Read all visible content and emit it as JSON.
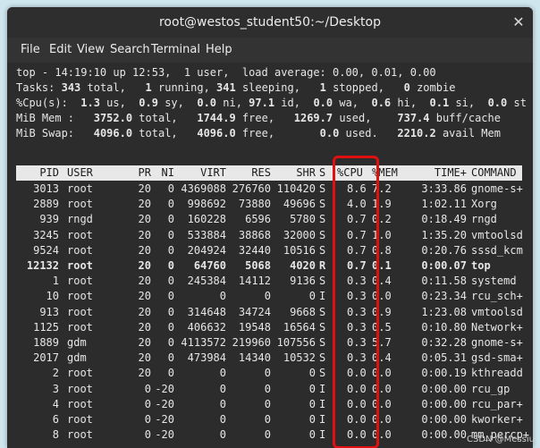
{
  "window": {
    "title": "root@westos_student50:~/Desktop"
  },
  "menu": [
    "File",
    "Edit",
    "View",
    "Search",
    "Terminal",
    "Help"
  ],
  "summary": {
    "line1": "top - 14:19:10 up 12:53,  1 user,  load average: 0.00, 0.01, 0.00",
    "tasks": {
      "label": "Tasks:",
      "total": "343",
      "total_lbl": " total,",
      "running": "1",
      "running_lbl": " running,",
      "sleeping": "341",
      "sleeping_lbl": " sleeping,",
      "stopped": "1",
      "stopped_lbl": " stopped,",
      "zombie": "0",
      "zombie_lbl": " zombie"
    },
    "cpu": {
      "label": "%Cpu(s):",
      "us": "1.3",
      "us_lbl": " us,",
      "sy": "0.9",
      "sy_lbl": " sy,",
      "ni": "0.0",
      "ni_lbl": " ni,",
      "id": "97.1",
      "id_lbl": " id,",
      "wa": "0.0",
      "wa_lbl": " wa,",
      "hi": "0.6",
      "hi_lbl": " hi,",
      "si": "0.1",
      "si_lbl": " si,",
      "st": "0.0",
      "st_lbl": " st"
    },
    "mem": {
      "label": "MiB Mem :",
      "total": "3752.0",
      "total_lbl": " total,",
      "free": "1744.9",
      "free_lbl": " free,",
      "used": "1269.7",
      "used_lbl": " used,",
      "buff": "737.4",
      "buff_lbl": " buff/cache"
    },
    "swap": {
      "label": "MiB Swap:",
      "total": "4096.0",
      "total_lbl": " total,",
      "free": "4096.0",
      "free_lbl": " free,",
      "used": "0.0",
      "used_lbl": " used.",
      "avail": "2210.2",
      "avail_lbl": " avail Mem"
    }
  },
  "table": {
    "headers": {
      "pid": "PID",
      "user": "USER",
      "pr": "PR",
      "ni": "NI",
      "virt": "VIRT",
      "res": "RES",
      "shr": "SHR",
      "s": "S",
      "cpu": "%CPU",
      "mem": "%MEM",
      "time": "TIME+",
      "command": "COMMAND"
    },
    "rows": [
      {
        "pid": "3013",
        "user": "root",
        "pr": "20",
        "ni": "0",
        "virt": "4369088",
        "res": "276760",
        "shr": "110420",
        "s": "S",
        "cpu": "8.6",
        "mem": "7.2",
        "time": "3:33.86",
        "command": "gnome-s+"
      },
      {
        "pid": "2889",
        "user": "root",
        "pr": "20",
        "ni": "0",
        "virt": "998692",
        "res": "73880",
        "shr": "49696",
        "s": "S",
        "cpu": "4.0",
        "mem": "1.9",
        "time": "1:02.11",
        "command": "Xorg"
      },
      {
        "pid": "939",
        "user": "rngd",
        "pr": "20",
        "ni": "0",
        "virt": "160228",
        "res": "6596",
        "shr": "5780",
        "s": "S",
        "cpu": "0.7",
        "mem": "0.2",
        "time": "0:18.49",
        "command": "rngd"
      },
      {
        "pid": "3245",
        "user": "root",
        "pr": "20",
        "ni": "0",
        "virt": "533884",
        "res": "38868",
        "shr": "32000",
        "s": "S",
        "cpu": "0.7",
        "mem": "1.0",
        "time": "1:35.20",
        "command": "vmtoolsd"
      },
      {
        "pid": "9524",
        "user": "root",
        "pr": "20",
        "ni": "0",
        "virt": "204924",
        "res": "32440",
        "shr": "10516",
        "s": "S",
        "cpu": "0.7",
        "mem": "0.8",
        "time": "0:20.76",
        "command": "sssd_kcm"
      },
      {
        "pid": "12132",
        "user": "root",
        "pr": "20",
        "ni": "0",
        "virt": "64760",
        "res": "5068",
        "shr": "4020",
        "s": "R",
        "cpu": "0.7",
        "mem": "0.1",
        "time": "0:00.07",
        "command": "top",
        "bold": true
      },
      {
        "pid": "1",
        "user": "root",
        "pr": "20",
        "ni": "0",
        "virt": "245384",
        "res": "14112",
        "shr": "9136",
        "s": "S",
        "cpu": "0.3",
        "mem": "0.4",
        "time": "0:11.58",
        "command": "systemd"
      },
      {
        "pid": "10",
        "user": "root",
        "pr": "20",
        "ni": "0",
        "virt": "0",
        "res": "0",
        "shr": "0",
        "s": "I",
        "cpu": "0.3",
        "mem": "0.0",
        "time": "0:23.34",
        "command": "rcu_sch+"
      },
      {
        "pid": "913",
        "user": "root",
        "pr": "20",
        "ni": "0",
        "virt": "314648",
        "res": "34724",
        "shr": "9668",
        "s": "S",
        "cpu": "0.3",
        "mem": "0.9",
        "time": "1:23.08",
        "command": "vmtoolsd"
      },
      {
        "pid": "1125",
        "user": "root",
        "pr": "20",
        "ni": "0",
        "virt": "406632",
        "res": "19548",
        "shr": "16564",
        "s": "S",
        "cpu": "0.3",
        "mem": "0.5",
        "time": "0:10.80",
        "command": "Network+"
      },
      {
        "pid": "1889",
        "user": "gdm",
        "pr": "20",
        "ni": "0",
        "virt": "4113572",
        "res": "219960",
        "shr": "107556",
        "s": "S",
        "cpu": "0.3",
        "mem": "5.7",
        "time": "0:32.28",
        "command": "gnome-s+"
      },
      {
        "pid": "2017",
        "user": "gdm",
        "pr": "20",
        "ni": "0",
        "virt": "473984",
        "res": "14340",
        "shr": "10532",
        "s": "S",
        "cpu": "0.3",
        "mem": "0.4",
        "time": "0:05.31",
        "command": "gsd-sma+"
      },
      {
        "pid": "2",
        "user": "root",
        "pr": "20",
        "ni": "0",
        "virt": "0",
        "res": "0",
        "shr": "0",
        "s": "S",
        "cpu": "0.0",
        "mem": "0.0",
        "time": "0:00.19",
        "command": "kthreadd"
      },
      {
        "pid": "3",
        "user": "root",
        "pr": "0",
        "ni": "-20",
        "virt": "0",
        "res": "0",
        "shr": "0",
        "s": "I",
        "cpu": "0.0",
        "mem": "0.0",
        "time": "0:00.00",
        "command": "rcu_gp"
      },
      {
        "pid": "4",
        "user": "root",
        "pr": "0",
        "ni": "-20",
        "virt": "0",
        "res": "0",
        "shr": "0",
        "s": "I",
        "cpu": "0.0",
        "mem": "0.0",
        "time": "0:00.00",
        "command": "rcu_par+"
      },
      {
        "pid": "6",
        "user": "root",
        "pr": "0",
        "ni": "-20",
        "virt": "0",
        "res": "0",
        "shr": "0",
        "s": "I",
        "cpu": "0.0",
        "mem": "0.0",
        "time": "0:00.00",
        "command": "kworker+"
      },
      {
        "pid": "8",
        "user": "root",
        "pr": "0",
        "ni": "-20",
        "virt": "0",
        "res": "0",
        "shr": "0",
        "s": "I",
        "cpu": "0.0",
        "mem": "0.0",
        "time": "0:00.00",
        "command": "mm_percp+"
      }
    ]
  },
  "watermark": "CSDN @Messiu",
  "colors": {
    "highlight": "#e01010",
    "terminal_bg": "#2c2c2c",
    "header_bg": "#e8e8e8"
  }
}
